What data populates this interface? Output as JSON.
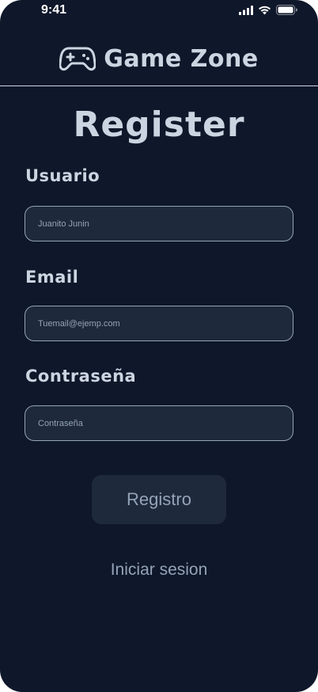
{
  "status_bar": {
    "time": "9:41"
  },
  "header": {
    "app_title": "Game Zone",
    "icon": "gamepad-icon"
  },
  "page": {
    "title": "Register"
  },
  "form": {
    "username": {
      "label": "Usuario",
      "placeholder": "Juanito Junin",
      "value": ""
    },
    "email": {
      "label": "Email",
      "placeholder": "Tuemail@ejemp.com",
      "value": ""
    },
    "password": {
      "label": "Contraseña",
      "placeholder": "Contraseña",
      "value": ""
    },
    "submit_label": "Registro",
    "login_link": "Iniciar sesion"
  },
  "colors": {
    "background": "#0f172a",
    "input_background": "#1e293b",
    "text": "#cbd5e1",
    "muted_text": "#94a3b8"
  }
}
